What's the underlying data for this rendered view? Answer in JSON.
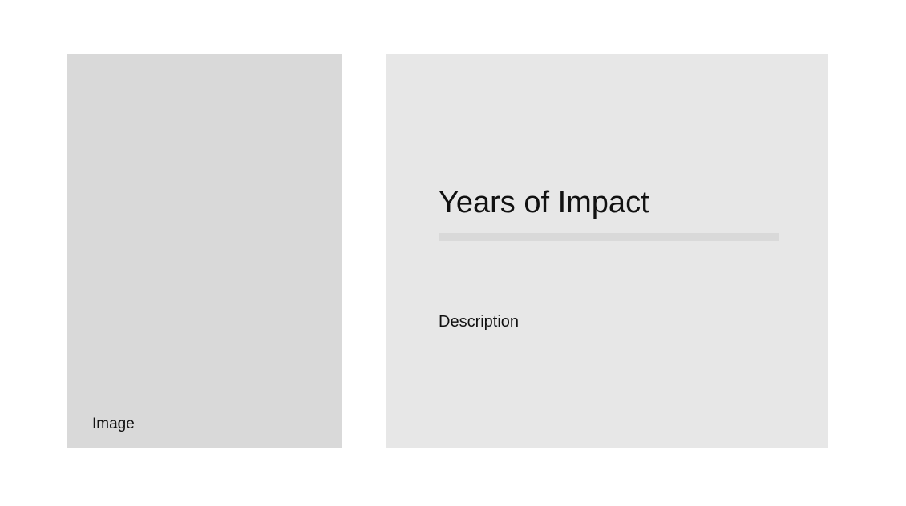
{
  "media": {
    "image_label": "Image"
  },
  "content": {
    "title": "Years of Impact",
    "description": "Description"
  },
  "colors": {
    "page_background": "#ffffff",
    "image_placeholder": "#d9d9d9",
    "content_background": "#e7e7e7",
    "title_underline": "#d9d9d9",
    "text": "#111111"
  }
}
